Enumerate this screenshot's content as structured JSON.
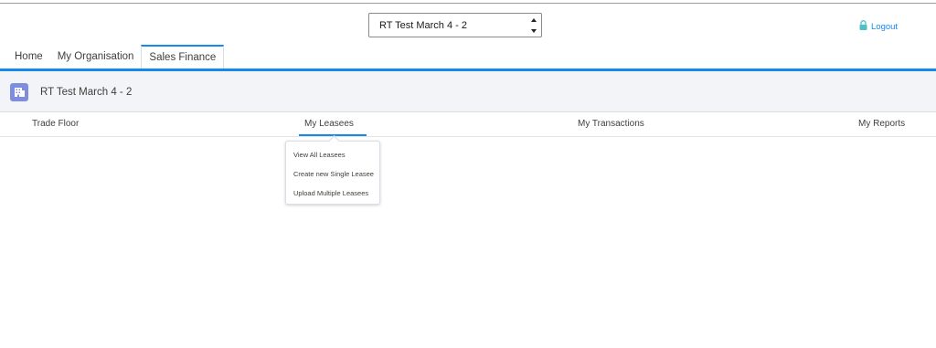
{
  "org_selector": {
    "value": "RT Test March 4 - 2"
  },
  "header": {
    "logout_label": "Logout"
  },
  "tabs": [
    {
      "label": "Home"
    },
    {
      "label": "My Organisation"
    },
    {
      "label": "Sales Finance",
      "active": true
    }
  ],
  "context": {
    "org_name": "RT Test March 4 - 2"
  },
  "subnav": [
    {
      "label": "Trade Floor"
    },
    {
      "label": "My Leasees",
      "active": true
    },
    {
      "label": "My Transactions"
    },
    {
      "label": "My Reports"
    }
  ],
  "dropdown": {
    "items": [
      {
        "label": "View All Leasees"
      },
      {
        "label": "Create new Single Leasee"
      },
      {
        "label": "Upload Multiple Leasees"
      }
    ]
  },
  "colors": {
    "accent": "#1589ee",
    "badge": "#7f8de1",
    "context_bg": "#f3f4f8"
  },
  "icons": {
    "logout": "lock-icon",
    "org_badge": "building-icon",
    "select": "up-down-arrows-icon"
  }
}
